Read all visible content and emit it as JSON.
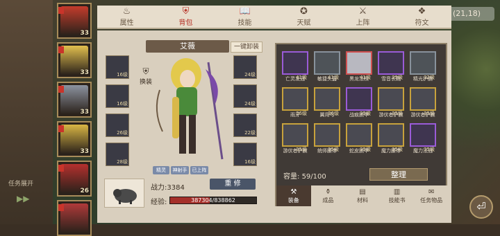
{
  "coords": "(21,18)",
  "tabs": [
    {
      "label": "属性",
      "icon": "flame-icon"
    },
    {
      "label": "背包",
      "icon": "armor-icon"
    },
    {
      "label": "技能",
      "icon": "book-icon"
    },
    {
      "label": "天赋",
      "icon": "talent-icon"
    },
    {
      "label": "上阵",
      "icon": "crossed-swords-icon"
    },
    {
      "label": "符文",
      "icon": "rune-icon"
    }
  ],
  "characters": [
    {
      "level": "33",
      "color": "#c43c2c"
    },
    {
      "level": "33",
      "color": "#e3c04e"
    },
    {
      "level": "33",
      "color": "#8c93a0"
    },
    {
      "level": "33",
      "color": "#d9b645"
    },
    {
      "level": "26",
      "color": "#b5302e"
    },
    {
      "level": "",
      "color": "#b03a3a"
    }
  ],
  "hero": {
    "name": "艾薇",
    "unequip_all": "一键卸装",
    "swap_label": "换装",
    "slots_left": [
      {
        "level": "16级"
      },
      {
        "level": "16级"
      },
      {
        "level": "26级"
      },
      {
        "level": "28级"
      }
    ],
    "slots_right": [
      {
        "level": "24级"
      },
      {
        "level": "24级"
      },
      {
        "level": "22级"
      },
      {
        "level": "16级"
      }
    ],
    "chips": [
      "精灵",
      "神射手",
      "已上阵"
    ],
    "power_label": "战力:",
    "power_value": "3384",
    "upgrade_label": "重 修",
    "exp_label": "经验:",
    "exp_text": "387304/838862",
    "exp_fraction": 0.46
  },
  "task_tip": "任务展开",
  "inventory": [
    {
      "name": "亡灵发冠",
      "level": "41级",
      "tier": "purple"
    },
    {
      "name": "敏捷头盔",
      "level": "41级",
      "tier": "gray"
    },
    {
      "name": "黑龙法杖",
      "level": "41级",
      "tier": "red"
    },
    {
      "name": "雪音长靴",
      "level": "39级",
      "tier": "purple"
    },
    {
      "name": "精光护腕",
      "level": "32级",
      "tier": "gray"
    },
    {
      "name": "雨牙",
      "level": "36级",
      "tier": "gold"
    },
    {
      "name": "翼用弓",
      "level": "36级",
      "tier": "gold"
    },
    {
      "name": "战痕腕甲",
      "level": "35级",
      "tier": "purple"
    },
    {
      "name": "游伏者护腕",
      "level": "35级",
      "tier": "gold"
    },
    {
      "name": "游伏者护腕",
      "level": "35级",
      "tier": "gold"
    },
    {
      "name": "游伏者护腕",
      "level": "35级",
      "tier": "gold"
    },
    {
      "name": "统师腰带",
      "level": "35级",
      "tier": "gold"
    },
    {
      "name": "蛇皮腕甲",
      "level": "35级",
      "tier": "gold"
    },
    {
      "name": "魔力腰带",
      "level": "35级",
      "tier": "gold"
    },
    {
      "name": "魔力法冠",
      "level": "35级",
      "tier": "purple"
    }
  ],
  "capacity_label": "容量:",
  "capacity_value": "59/100",
  "sort_label": "整理",
  "bottom_tabs": [
    {
      "label": "装备",
      "icon": "hammer-icon"
    },
    {
      "label": "成品",
      "icon": "potion-icon"
    },
    {
      "label": "材料",
      "icon": "material-icon"
    },
    {
      "label": "技能书",
      "icon": "skillbook-icon"
    },
    {
      "label": "任务物品",
      "icon": "quest-icon"
    }
  ]
}
